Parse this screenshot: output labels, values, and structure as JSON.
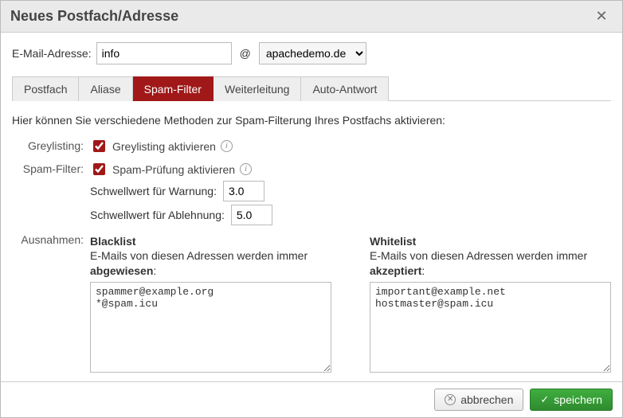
{
  "title": "Neues Postfach/Adresse",
  "email": {
    "label": "E-Mail-Adresse:",
    "local": "info",
    "at": "@",
    "domain": "apachedemo.de"
  },
  "tabs": {
    "postfach": "Postfach",
    "aliase": "Aliase",
    "spam": "Spam-Filter",
    "weiterleitung": "Weiterleitung",
    "autoantwort": "Auto-Antwort"
  },
  "intro": "Hier können Sie verschiedene Methoden zur Spam-Filterung Ihres Postfachs aktivieren:",
  "greylisting": {
    "label": "Greylisting:",
    "checkbox": "Greylisting aktivieren"
  },
  "spamfilter": {
    "label": "Spam-Filter:",
    "checkbox": "Spam-Prüfung aktivieren",
    "warn_label": "Schwellwert für Warnung:",
    "warn_value": "3.0",
    "reject_label": "Schwellwert für Ablehnung:",
    "reject_value": "5.0"
  },
  "exceptions": {
    "label": "Ausnahmen:",
    "blacklist": {
      "title": "Blacklist",
      "desc_pre": "E-Mails von diesen Adressen werden immer ",
      "desc_strong": "abgewiesen",
      "value": "spammer@example.org\n*@spam.icu"
    },
    "whitelist": {
      "title": "Whitelist",
      "desc_pre": "E-Mails von diesen Adressen werden immer ",
      "desc_strong": "akzeptiert",
      "value": "important@example.net\nhostmaster@spam.icu"
    }
  },
  "buttons": {
    "cancel": "abbrechen",
    "save": "speichern"
  }
}
